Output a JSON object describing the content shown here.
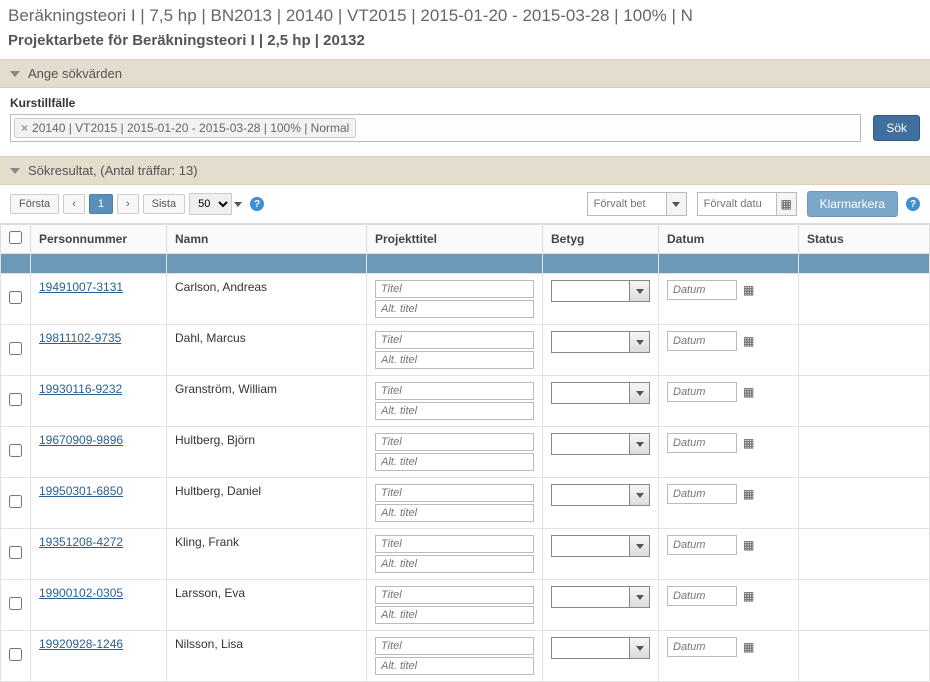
{
  "page": {
    "title": "Beräkningsteori I | 7,5 hp | BN2013 | 20140 | VT2015 | 2015-01-20 - 2015-03-28 | 100% | N",
    "subtitle": "Projektarbete för Beräkningsteori I | 2,5 hp | 20132"
  },
  "panels": {
    "search_header": "Ange sökvärden",
    "results_header": "Sökresultat, (Antal träffar: 13)"
  },
  "search": {
    "label": "Kurstillfälle",
    "tag": "20140 | VT2015 | 2015-01-20 - 2015-03-28 | 100% | Normal",
    "button": "Sök"
  },
  "pager": {
    "first": "Första",
    "prev": "‹",
    "current": "1",
    "next": "›",
    "last": "Sista",
    "page_size": "50"
  },
  "toolbar": {
    "default_grade_placeholder": "Förvalt bet",
    "default_date_placeholder": "Förvalt datu",
    "mark_done": "Klarmarkera"
  },
  "columns": {
    "personnummer": "Personnummer",
    "namn": "Namn",
    "projekttitel": "Projekttitel",
    "betyg": "Betyg",
    "datum": "Datum",
    "status": "Status"
  },
  "placeholders": {
    "titel": "Titel",
    "alt_titel": "Alt. titel",
    "datum": "Datum"
  },
  "rows": [
    {
      "pn": "19491007-3131",
      "name": "Carlson, Andreas"
    },
    {
      "pn": "19811102-9735",
      "name": "Dahl, Marcus"
    },
    {
      "pn": "19930116-9232",
      "name": "Granström, William"
    },
    {
      "pn": "19670909-9896",
      "name": "Hultberg, Björn"
    },
    {
      "pn": "19950301-6850",
      "name": "Hultberg, Daniel"
    },
    {
      "pn": "19351208-4272",
      "name": "Kling, Frank"
    },
    {
      "pn": "19900102-0305",
      "name": "Larsson, Eva"
    },
    {
      "pn": "19920928-1246",
      "name": "Nilsson, Lisa"
    }
  ]
}
